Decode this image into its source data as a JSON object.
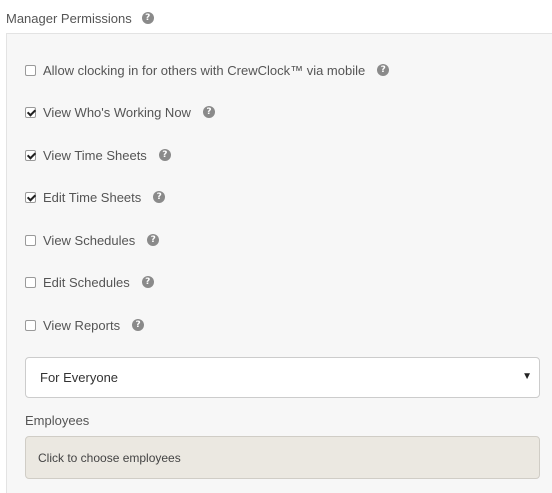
{
  "header": {
    "title": "Manager Permissions",
    "help_icon": "question-circle-icon"
  },
  "permissions": [
    {
      "label": "Allow clocking in for others with CrewClock™ via mobile",
      "checked": false
    },
    {
      "label": "View Who's Working Now",
      "checked": true
    },
    {
      "label": "View Time Sheets",
      "checked": true
    },
    {
      "label": "Edit Time Sheets",
      "checked": true
    },
    {
      "label": "View Schedules",
      "checked": false
    },
    {
      "label": "Edit Schedules",
      "checked": false
    },
    {
      "label": "View Reports",
      "checked": false
    }
  ],
  "scope_select": {
    "selected": "For Everyone"
  },
  "employees": {
    "label": "Employees",
    "placeholder": "Click to choose employees"
  }
}
